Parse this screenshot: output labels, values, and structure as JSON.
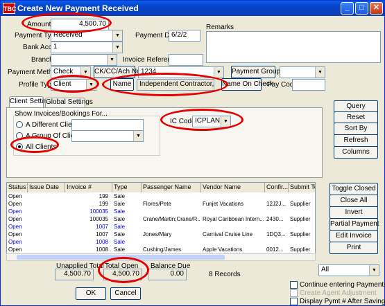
{
  "window": {
    "title": "Create New Payment Received",
    "logo": "TBC"
  },
  "form": {
    "amount_label": "Amount",
    "amount_value": "4,500.70",
    "payment_type_label": "Payment Type",
    "payment_type_value": "Received",
    "bank_acct_label": "Bank Acct",
    "bank_acct_value": "1",
    "branch_label": "Branch",
    "branch_value": "",
    "payment_date_label": "Payment Date",
    "payment_date_value": "6/2/2",
    "invoice_ref_label": "Invoice Reference",
    "invoice_ref_value": "",
    "remarks_label": "Remarks",
    "payment_method_label": "Payment Method",
    "payment_method_value": "Check",
    "ck_button": "CK/CC/Ach No",
    "ck_value": "1234",
    "payment_group_button": "Payment Group",
    "payment_group_value": "",
    "profile_type_label": "Profile Type",
    "profile_type_value": "Client",
    "name_button": "Name",
    "name_value": "Independent Contractor, Inc.",
    "name_on_check_button": "Name On Check",
    "pay_code_label": "Pay Code",
    "pay_code_value": ""
  },
  "tabs": {
    "client_settings": "Client Settings",
    "global_settings": "Global Settings"
  },
  "show_for": {
    "group_label": "Show Invoices/Bookings For...",
    "different_client": "A Different Client",
    "group_of_clients": "A Group Of Clients",
    "all_clients": "All Clients",
    "ic_code_label": "IC Code",
    "ic_code_value": "ICPLANIT"
  },
  "side_buttons": [
    "Query",
    "Reset",
    "Sort By",
    "Refresh",
    "Columns"
  ],
  "grid": {
    "columns": [
      "Status",
      "Issue Date",
      "Invoice #",
      "Type",
      "Passenger Name",
      "Vendor Name",
      "Confir...",
      "Submit To"
    ],
    "rows": [
      {
        "status": "Open",
        "date": "",
        "invoice": "199",
        "type": "Sale",
        "passenger": "",
        "vendor": "",
        "conf": "",
        "submit": "",
        "blue": false
      },
      {
        "status": "Open",
        "date": "",
        "invoice": "199",
        "type": "Sale",
        "passenger": "Flores/Pete",
        "vendor": "Funjet Vacations",
        "conf": "12J2J...",
        "submit": "Supplier",
        "blue": false
      },
      {
        "status": "Open",
        "date": "",
        "invoice": "100035",
        "type": "Sale",
        "passenger": "",
        "vendor": "",
        "conf": "",
        "submit": "",
        "blue": true
      },
      {
        "status": "Open",
        "date": "",
        "invoice": "100035",
        "type": "Sale",
        "passenger": "Crane/Martin;Crane/R...",
        "vendor": "Royal Caribbean Intern...",
        "conf": "2430...",
        "submit": "Supplier",
        "blue": false
      },
      {
        "status": "Open",
        "date": "",
        "invoice": "1007",
        "type": "Sale",
        "passenger": "",
        "vendor": "",
        "conf": "",
        "submit": "",
        "blue": true
      },
      {
        "status": "Open",
        "date": "",
        "invoice": "1007",
        "type": "Sale",
        "passenger": "Jones/Mary",
        "vendor": "Carnival Cruise Line",
        "conf": "1DQ3...",
        "submit": "Supplier",
        "blue": false
      },
      {
        "status": "Open",
        "date": "",
        "invoice": "1008",
        "type": "Sale",
        "passenger": "",
        "vendor": "",
        "conf": "",
        "submit": "",
        "blue": true
      },
      {
        "status": "Open",
        "date": "",
        "invoice": "1008",
        "type": "Sale",
        "passenger": "Cushing/James",
        "vendor": "Apple Vacations",
        "conf": "0012...",
        "submit": "Supplier",
        "blue": false
      }
    ]
  },
  "grid_buttons": [
    "Toggle Closed",
    "Close All",
    "Invert",
    "Partial Payment",
    "Edit Invoice",
    "Print"
  ],
  "totals": {
    "unapplied_label": "Unapplied Total",
    "unapplied_value": "4,500.70",
    "total_open_label": "Total Open",
    "total_open_value": "4,500.70",
    "balance_due_label": "Balance Due",
    "balance_due_value": "0.00",
    "records": "8 Records",
    "filter_value": "All"
  },
  "bottom": {
    "ok": "OK",
    "cancel": "Cancel",
    "continue_label": "Continue entering Payments",
    "agent_adj_label": "Create Agent Adjustment",
    "display_pymt_label": "Display Pymt # After Saving"
  }
}
